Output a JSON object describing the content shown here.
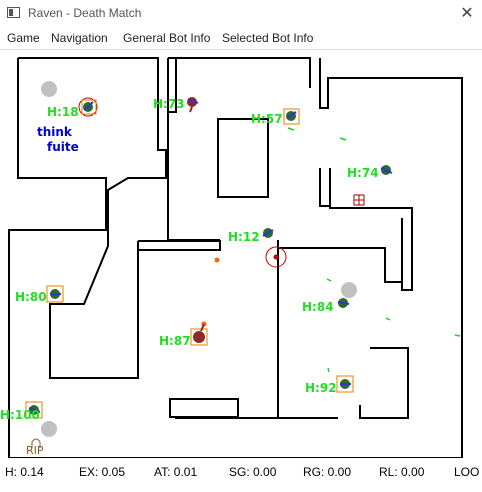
{
  "window": {
    "title": "Raven - Death Match",
    "close_icon": "close-icon"
  },
  "menu": {
    "items": [
      "Game",
      "Navigation",
      "General Bot Info",
      "Selected Bot Info"
    ]
  },
  "arena": {
    "bot_labels": [
      "H:18",
      "H:73",
      "H:57",
      "H:74",
      "H:12",
      "H:80",
      "H:84",
      "H:87",
      "H:92",
      "H:100"
    ],
    "thought_lines": [
      "think",
      "fuite"
    ],
    "grave_text": "RIP"
  },
  "status": {
    "h": "H: 0.14",
    "ex": "EX: 0.05",
    "at": "AT: 0.01",
    "sg": "SG: 0.00",
    "rg": "RG: 0.00",
    "rl": "RL: 0.00",
    "loo": "LOO"
  },
  "colors": {
    "health_label": "#22dd22",
    "thought": "#0000cc",
    "walls": "#000000",
    "bot_body": "#2a6b2a",
    "bot_target": "#cc0000"
  }
}
